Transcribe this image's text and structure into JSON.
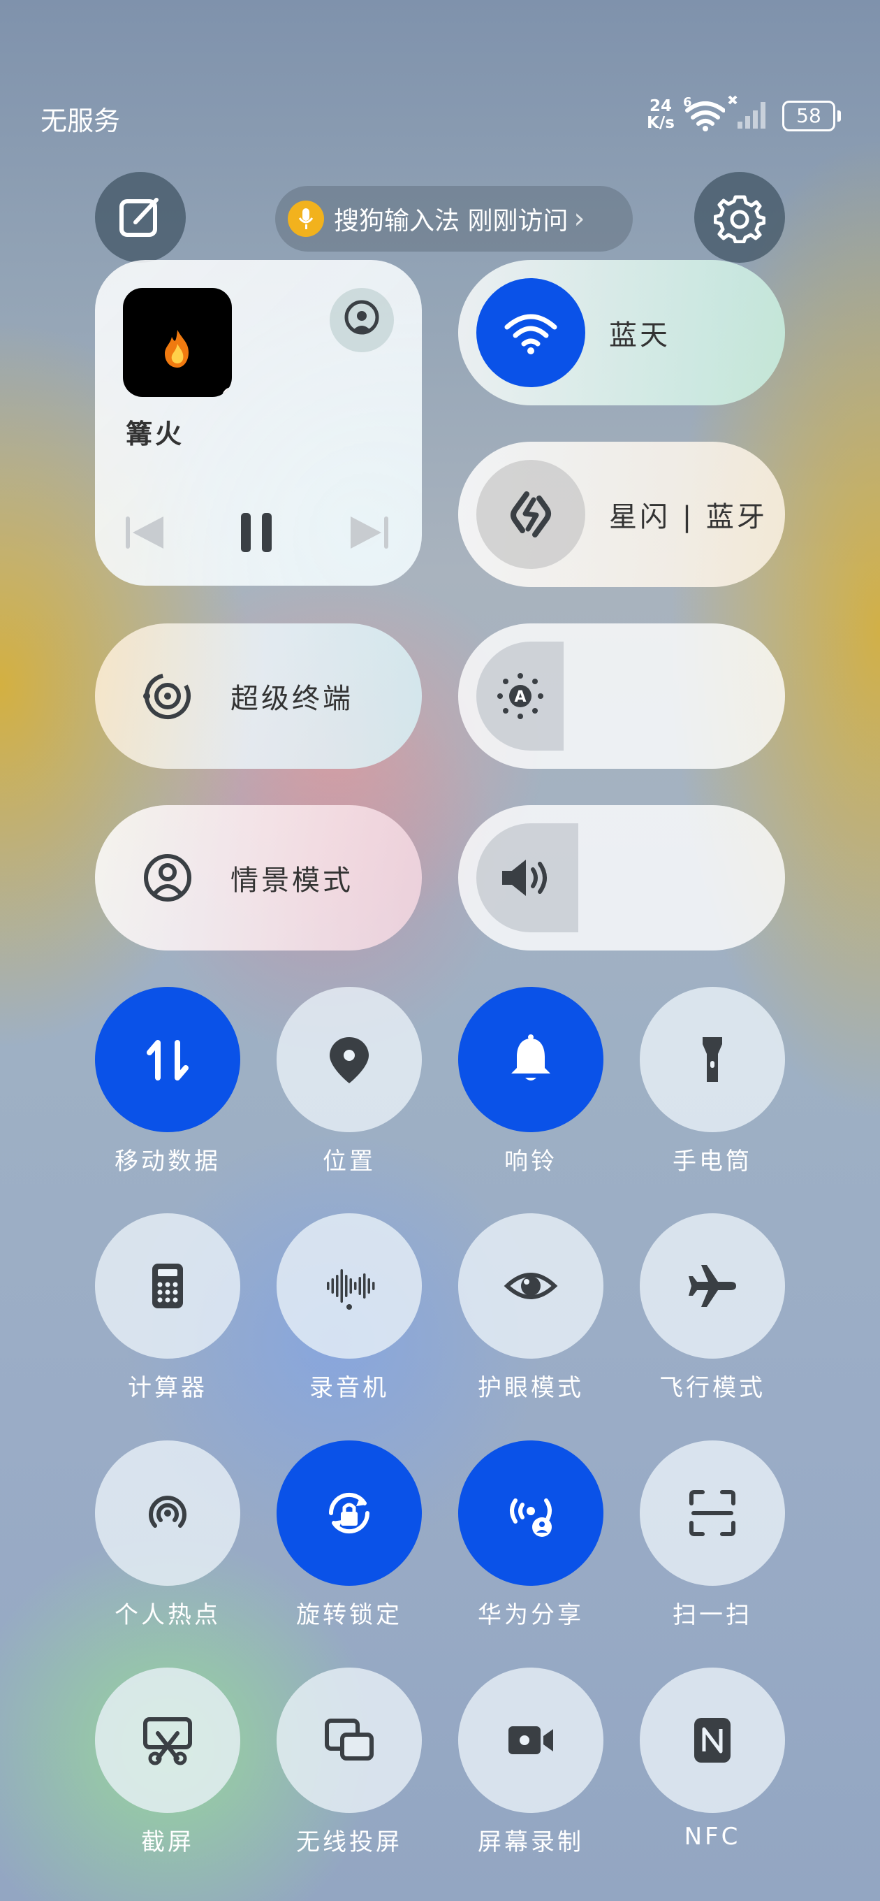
{
  "status_bar": {
    "carrier": "无服务",
    "speed_value": "24",
    "speed_unit": "K/s",
    "battery": "58"
  },
  "header": {
    "edit_icon": "edit-icon",
    "settings_icon": "gear-icon",
    "notice": "搜狗输入法 刚刚访问"
  },
  "media": {
    "song": "篝火",
    "album_icon": "flame-icon"
  },
  "wifi_card": {
    "label": "蓝天",
    "icon": "wifi-icon"
  },
  "bluetooth_card": {
    "label": "星闪 | 蓝牙",
    "icon": "nearlink-icon"
  },
  "super_device": {
    "label": "超级终端"
  },
  "scene_mode": {
    "label": "情景模式"
  },
  "brightness": {
    "level_percent": 30,
    "icon": "auto-brightness-icon"
  },
  "volume": {
    "level_percent": 35,
    "icon": "speaker-icon"
  },
  "tiles": [
    {
      "label": "移动数据",
      "icon": "mobile-data-icon",
      "on": true
    },
    {
      "label": "位置",
      "icon": "location-icon",
      "on": false
    },
    {
      "label": "响铃",
      "icon": "bell-icon",
      "on": true
    },
    {
      "label": "手电筒",
      "icon": "flashlight-icon",
      "on": false
    },
    {
      "label": "计算器",
      "icon": "calculator-icon",
      "on": false
    },
    {
      "label": "录音机",
      "icon": "recorder-icon",
      "on": false
    },
    {
      "label": "护眼模式",
      "icon": "eye-icon",
      "on": false
    },
    {
      "label": "飞行模式",
      "icon": "airplane-icon",
      "on": false
    },
    {
      "label": "个人热点",
      "icon": "hotspot-icon",
      "on": false
    },
    {
      "label": "旋转锁定",
      "icon": "rotation-lock-icon",
      "on": true
    },
    {
      "label": "华为分享",
      "icon": "huawei-share-icon",
      "on": true
    },
    {
      "label": "扫一扫",
      "icon": "scan-icon",
      "on": false
    },
    {
      "label": "截屏",
      "icon": "screenshot-icon",
      "on": false
    },
    {
      "label": "无线投屏",
      "icon": "wireless-projection-icon",
      "on": false
    },
    {
      "label": "屏幕录制",
      "icon": "screen-record-icon",
      "on": false
    },
    {
      "label": "NFC",
      "icon": "nfc-icon",
      "on": false
    }
  ],
  "colors": {
    "accent": "#0a52e8",
    "icon_dark": "#3a3f44"
  }
}
